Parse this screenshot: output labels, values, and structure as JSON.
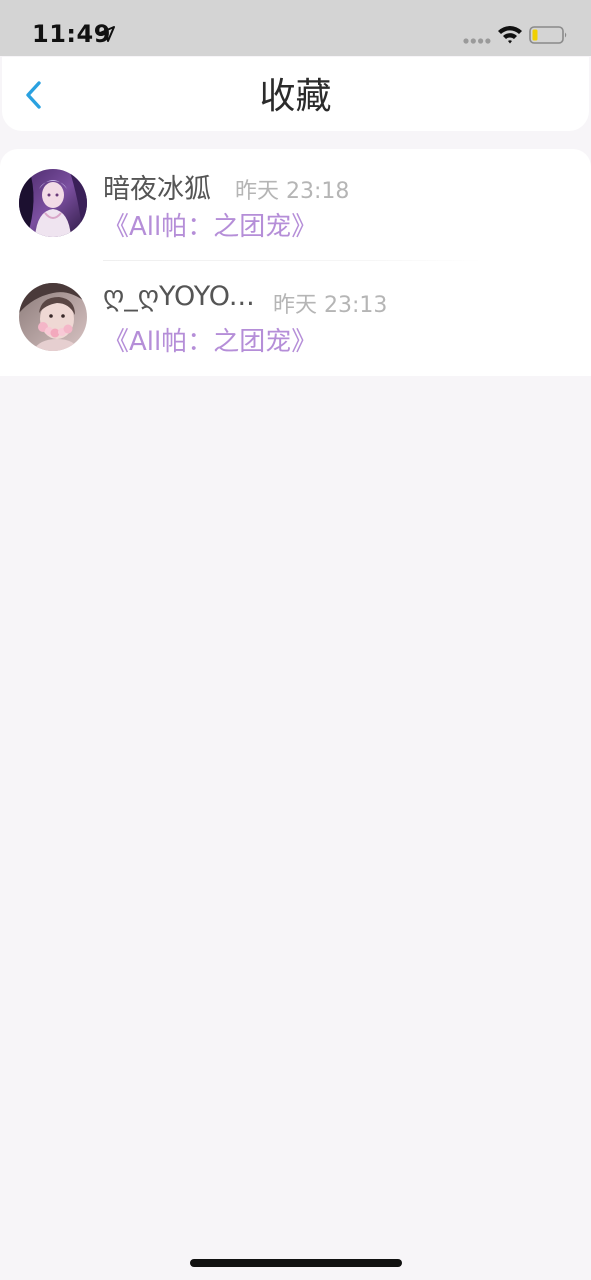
{
  "status_bar": {
    "time": "11:49",
    "icons": [
      "location-arrow-icon",
      "signal-dots-icon",
      "wifi-icon",
      "battery-icon"
    ],
    "battery_color": "#f0d000"
  },
  "nav": {
    "back_icon": "chevron-left-icon",
    "back_color": "#2aa1e0",
    "title": "收藏"
  },
  "favorites": [
    {
      "name": "暗夜冰狐",
      "time": "昨天 23:18",
      "title": "《All帕：之团宠》",
      "avatar": "avatar-image"
    },
    {
      "name": "ღ_ღYOYO...",
      "time": "昨天 23:13",
      "title": "《All帕：之团宠》",
      "avatar": "avatar-image"
    }
  ],
  "colors": {
    "accent_title": "#b58ed8",
    "page_background": "#f7f5f8"
  }
}
